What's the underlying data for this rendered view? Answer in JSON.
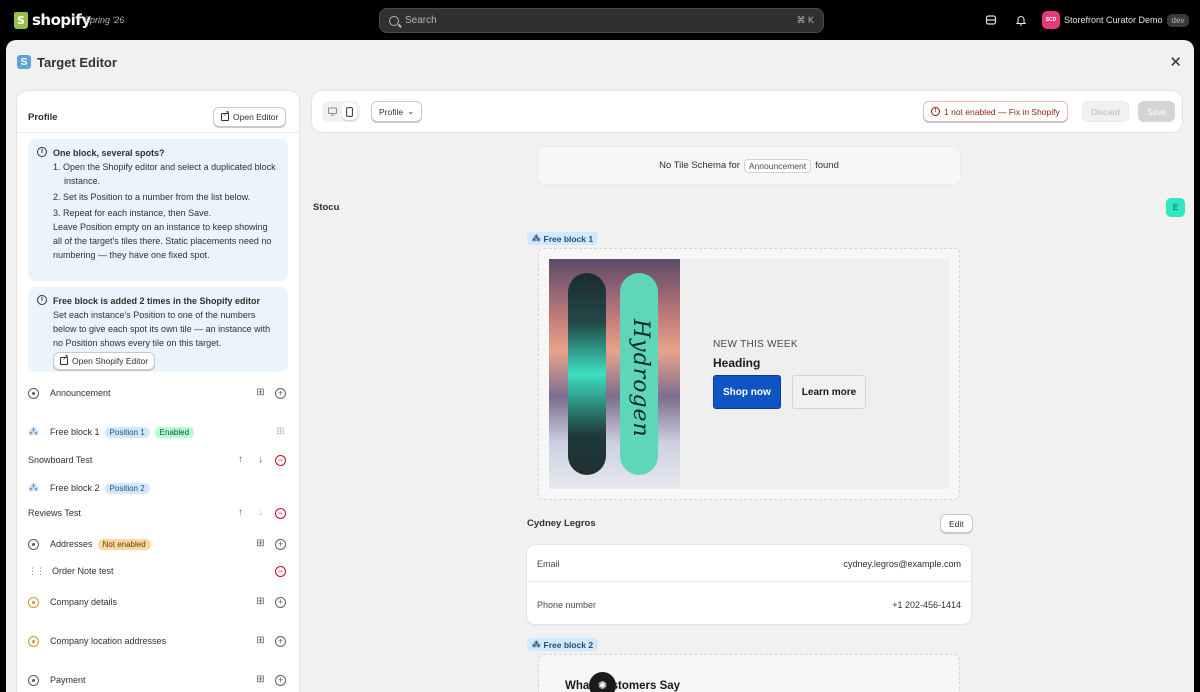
{
  "topbar": {
    "logo_text": "shopify",
    "edition": "Spring '26",
    "search_placeholder": "Search",
    "search_shortcut": "⌘  K",
    "store_initials": "SCD",
    "store_name": "Storefront Curator Demo",
    "store_env": "dev"
  },
  "modal": {
    "app_icon_letter": "S",
    "title": "Target Editor",
    "close_glyph": "✕"
  },
  "left_panel": {
    "title": "Profile",
    "open_editor_label": "Open Editor",
    "info_box_1": {
      "title": "One block, several spots?",
      "steps": [
        "1. Open the Shopify editor and select a duplicated block instance.",
        "2. Set its Position to a number from the list below.",
        "3. Repeat for each instance, then Save."
      ],
      "note": "Leave Position empty on an instance to keep showing all of the target's tiles there. Static placements need no numbering — they have one fixed spot."
    },
    "info_box_2": {
      "title": "Free block is added 2 times in the Shopify editor",
      "body": "Set each instance's Position to one of the numbers below to give each spot its own tile — an instance with no Position shows every tile on this target.",
      "button_label": "Open Shopify Editor"
    },
    "rows": [
      {
        "label": "Announcement"
      },
      {
        "label": "Free block 1",
        "badge_1": "Position 1",
        "badge_2": "Enabled"
      },
      {
        "label": "Snowboard Test"
      },
      {
        "label": "Free block 2",
        "badge_1": "Position 2"
      },
      {
        "label": "Reviews Test"
      },
      {
        "label": "Addresses",
        "badge_1": "Not enabled"
      },
      {
        "label": "Order Note test"
      },
      {
        "label": "Company details"
      },
      {
        "label": "Company location addresses"
      },
      {
        "label": "Payment"
      }
    ]
  },
  "toolbar": {
    "profile_label": "Profile",
    "warning_label": "1 not enabled — Fix in Shopify",
    "discard_label": "Discard",
    "save_label": "Save"
  },
  "preview": {
    "no_schema_prefix": "No Tile Schema for",
    "no_schema_chip": "Announcement",
    "no_schema_suffix": "found",
    "stocu": "Stocu",
    "e_badge": "E",
    "free_block_1_tag": "Free block 1",
    "hero": {
      "board_text": "Hydrogen",
      "eyebrow": "NEW THIS WEEK",
      "heading": "Heading",
      "primary_button": "Shop now",
      "secondary_button": "Learn more"
    },
    "customer": {
      "name": "Cydney Legros",
      "edit_label": "Edit",
      "email_label": "Email",
      "email_value": "cydney.legros@example.com",
      "phone_label": "Phone number",
      "phone_value": "+1 202-456-1414"
    },
    "free_block_2_tag": "Free block 2",
    "customers_say": "What Customers Say"
  },
  "colors": {
    "accent_blue": "#1054c4",
    "info_bg": "#eaf4fc",
    "badge_blue": "#d4e8fb",
    "badge_green": "#b4fed2",
    "badge_orange": "#ffd6a4",
    "critical": "#c70a24",
    "teal_badge": "#2ee8c2"
  }
}
